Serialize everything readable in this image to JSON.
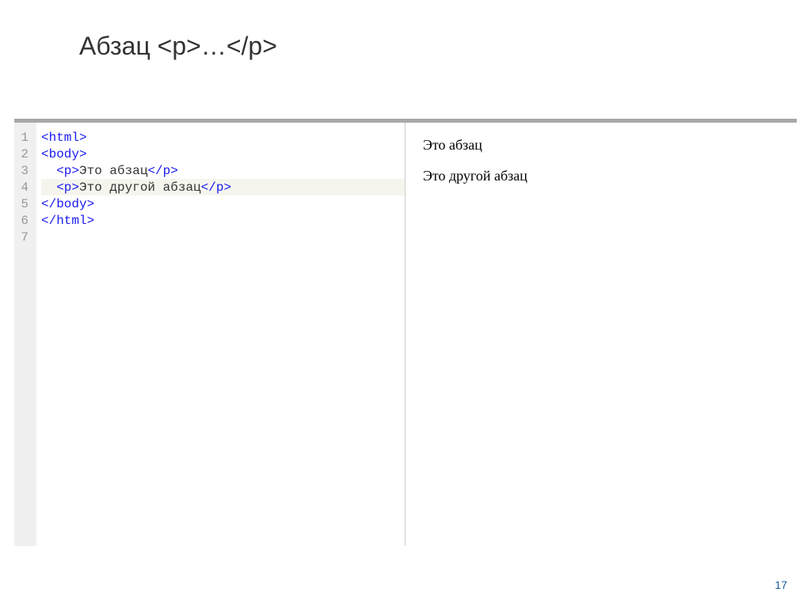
{
  "title": "Абзац <p>…</p>",
  "code": {
    "line1": {
      "tag_open": "<html>",
      "text": ""
    },
    "line2": {
      "tag_open": "<body>",
      "text": ""
    },
    "line3": {
      "indent": "  ",
      "tag_open": "<p>",
      "text": "Это абзац",
      "tag_close": "</p>"
    },
    "line4": {
      "indent": "  ",
      "tag_open": "<p>",
      "text": "Это другой абзац",
      "tag_close": "</p>"
    },
    "line5": {
      "tag_open": "</body>",
      "text": ""
    },
    "line6": {
      "tag_open": "</html>",
      "text": ""
    }
  },
  "gutter": [
    "1",
    "2",
    "3",
    "4",
    "5",
    "6",
    "7"
  ],
  "preview": {
    "p1": "Это абзац",
    "p2": "Это другой абзац"
  },
  "pageNumber": "17"
}
